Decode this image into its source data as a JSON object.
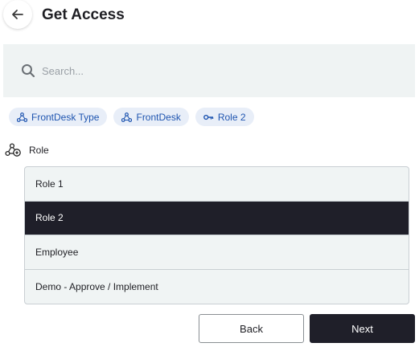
{
  "header": {
    "title": "Get Access"
  },
  "search": {
    "placeholder": "Search..."
  },
  "chips": [
    {
      "label": "FrontDesk Type",
      "icon": "network-icon"
    },
    {
      "label": "FrontDesk",
      "icon": "network-icon"
    },
    {
      "label": "Role 2",
      "icon": "key-icon"
    }
  ],
  "section": {
    "label": "Role",
    "icon": "network-role-icon"
  },
  "roles": {
    "items": [
      {
        "label": "Role 1",
        "selected": false
      },
      {
        "label": "Role 2",
        "selected": true
      },
      {
        "label": "Employee",
        "selected": false
      },
      {
        "label": "Demo - Approve / Implement",
        "selected": false
      }
    ]
  },
  "footer": {
    "back_label": "Back",
    "next_label": "Next"
  },
  "colors": {
    "accent_dark": "#1f1f29",
    "chip_bg": "#e8eef8",
    "chip_text": "#1f55b0",
    "panel_bg": "#eff3f3"
  }
}
